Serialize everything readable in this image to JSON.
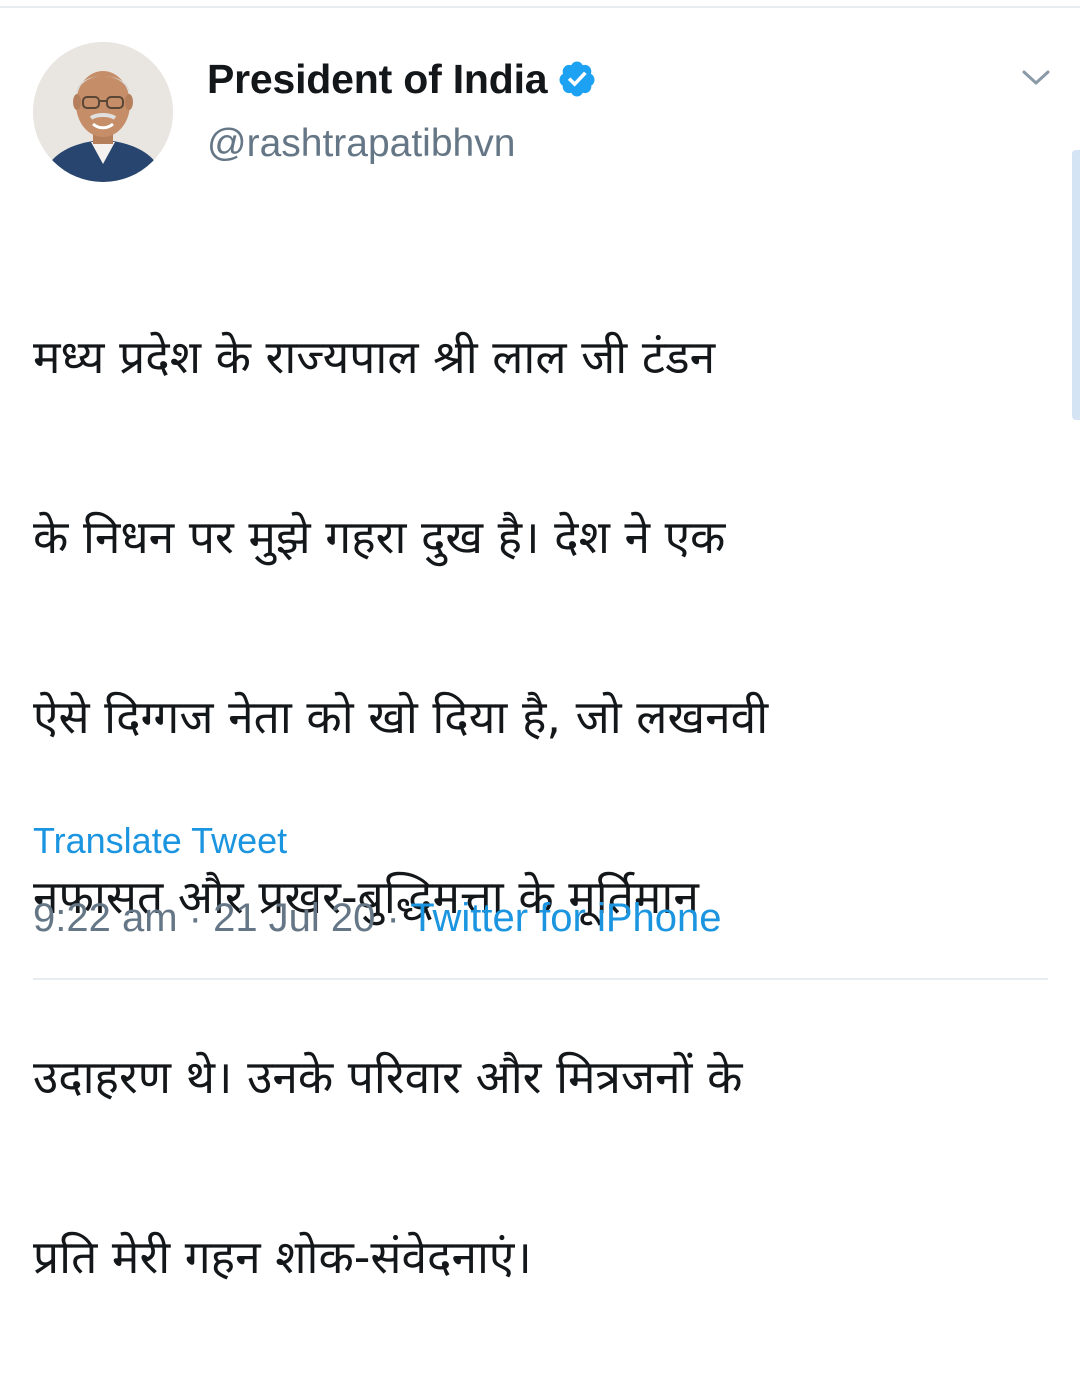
{
  "tweet": {
    "author_name": "President of India",
    "handle": "@rashtrapatibhvn",
    "verified_icon": "verified-badge-icon",
    "menu_icon": "chevron-down-icon",
    "body_lines": [
      "मध्य प्रदेश के राज्यपाल श्री लाल जी टंडन",
      "के निधन पर मुझे गहरा दुख है। देश ने एक",
      "ऐसे दिग्गज नेता को खो दिया है, जो लखनवी",
      "नफासत और प्रखर-बुद्धिमत्ता के मूर्तिमान",
      "उदाहरण थे। उनके परिवार और मित्रजनों के",
      "प्रति मेरी गहन शोक-संवेदनाएं।"
    ],
    "translate_label": "Translate Tweet",
    "time": "9:22 am",
    "separator": " · ",
    "date": "21 Jul 20",
    "source": "Twitter for iPhone"
  },
  "colors": {
    "accent": "#1b95e0",
    "verified": "#1da1f2",
    "text": "#14171a",
    "muted": "#657786"
  }
}
